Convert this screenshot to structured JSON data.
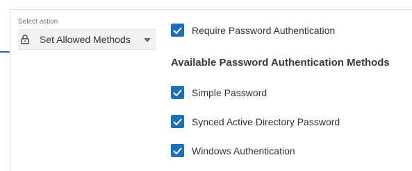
{
  "action_select": {
    "label": "Select action",
    "value": "Set Allowed Methods",
    "icon": "lock-icon"
  },
  "require_password": {
    "label": "Require Password Authentication",
    "checked": true
  },
  "methods_section": {
    "title": "Available Password Authentication Methods",
    "items": [
      {
        "label": "Simple Password",
        "checked": true
      },
      {
        "label": "Synced Active Directory Password",
        "checked": true
      },
      {
        "label": "Windows Authentication",
        "checked": true
      }
    ]
  },
  "colors": {
    "accent": "#1f6fb8",
    "select_bg": "#f2f2f2",
    "divider": "#dcdcdc"
  }
}
